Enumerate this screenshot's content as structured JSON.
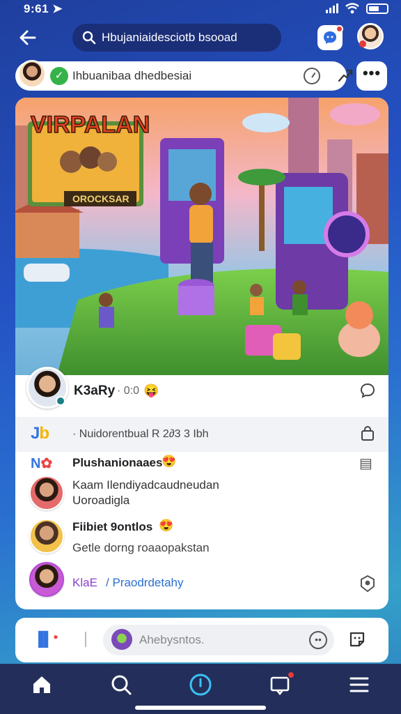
{
  "status_bar": {
    "time": "9:61 ➤"
  },
  "top_nav": {
    "search_text": "Hbujaniaidesciotb bsooad",
    "messages_badge": "!"
  },
  "composer": {
    "text": "Ihbuanibaa dhedbesiai"
  },
  "post": {
    "image_title": "VIRPALAN",
    "image_sign": "OROCKSAR",
    "author_name": "K3aRy",
    "author_meta": "· 0:0",
    "author_emoji": "😝",
    "tagline_logo_a": "J",
    "tagline_logo_b": "b",
    "tagline": "· Nuidorentbual R 2∂3 3 Ibh"
  },
  "comments": [
    {
      "name": "Plushanionaaes",
      "emoji": "😍",
      "text": ""
    },
    {
      "name": "",
      "emoji": "",
      "text": "Kaam Ilendiyadcaudneudan",
      "text2": "Uoroadigla"
    },
    {
      "name": "Fiibiet 9ontlos",
      "emoji": "😍",
      "text": "Getle dorng roaaopakstan"
    },
    {
      "name": "KlaE",
      "emoji": "",
      "text": "/ Praodrdetahy"
    }
  ],
  "input_bar": {
    "placeholder": "Ahebysntos."
  },
  "tabs": [
    "home",
    "search",
    "create",
    "notifications",
    "menu"
  ],
  "colors": {
    "accent": "#3cc2f5",
    "brand": "#2f6de0",
    "tab_bar": "#232f5a"
  }
}
